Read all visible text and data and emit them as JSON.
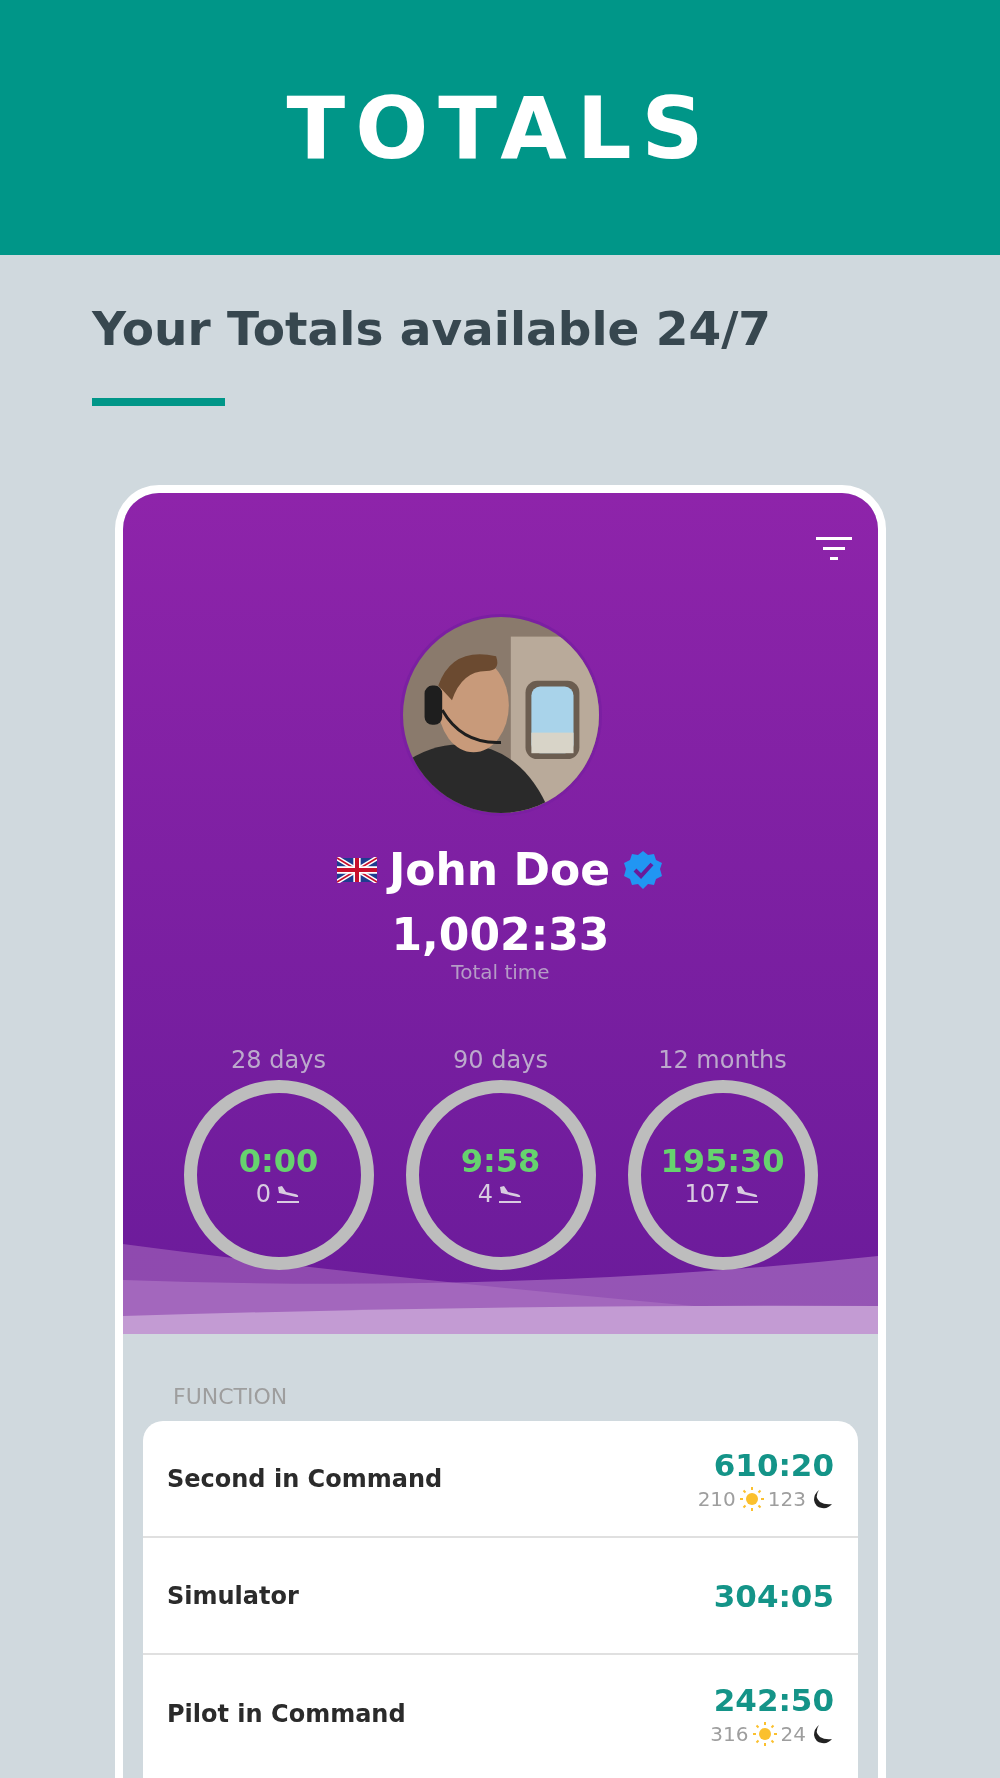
{
  "header": {
    "title": "TOTALS"
  },
  "tagline": "Your Totals available 24/7",
  "profile": {
    "name": "John Doe",
    "verified": true,
    "total": "1,002:33",
    "total_label": "Total time"
  },
  "periods": [
    {
      "label": "28 days",
      "time": "0:00",
      "landings": "0"
    },
    {
      "label": "90 days",
      "time": "9:58",
      "landings": "4"
    },
    {
      "label": "12 months",
      "time": "195:30",
      "landings": "107"
    }
  ],
  "section_label": "FUNCTION",
  "functions": [
    {
      "name": "Second in Command",
      "time": "610:20",
      "day": "210",
      "night": "123"
    },
    {
      "name": "Simulator",
      "time": "304:05"
    },
    {
      "name": "Pilot in Command",
      "time": "242:50",
      "day": "316",
      "night": "24"
    }
  ]
}
